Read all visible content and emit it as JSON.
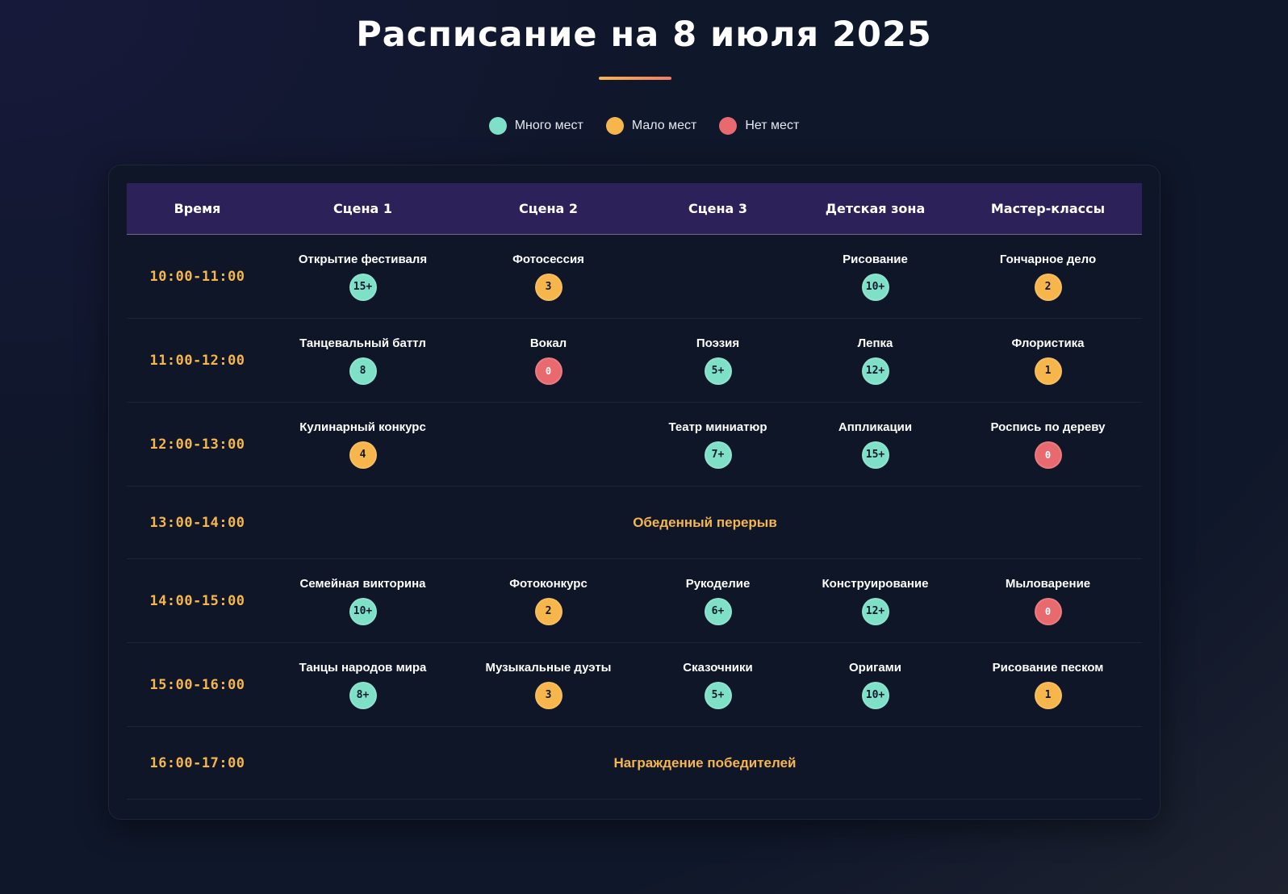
{
  "title": "Расписание на 8 июля 2025",
  "colors": {
    "accent": "#f6b64b",
    "header_bg": "#2c2259",
    "many": "#7fe0c8",
    "few": "#f6b64b",
    "none": "#e86a6e",
    "background": "#0f172a"
  },
  "legend": [
    {
      "status": "many",
      "label": "Много мест"
    },
    {
      "status": "few",
      "label": "Мало мест"
    },
    {
      "status": "none",
      "label": "Нет мест"
    }
  ],
  "table": {
    "headers": [
      "Время",
      "Сцена 1",
      "Сцена 2",
      "Сцена 3",
      "Детская зона",
      "Мастер-классы"
    ],
    "rows": [
      {
        "time": "10:00-11:00",
        "cells": [
          {
            "name": "Открытие фестиваля",
            "seats": "15+",
            "status": "many"
          },
          {
            "name": "Фотосессия",
            "seats": "3",
            "status": "few"
          },
          null,
          {
            "name": "Рисование",
            "seats": "10+",
            "status": "many"
          },
          {
            "name": "Гончарное дело",
            "seats": "2",
            "status": "few"
          }
        ]
      },
      {
        "time": "11:00-12:00",
        "cells": [
          {
            "name": "Танцевальный баттл",
            "seats": "8",
            "status": "many"
          },
          {
            "name": "Вокал",
            "seats": "0",
            "status": "none"
          },
          {
            "name": "Поэзия",
            "seats": "5+",
            "status": "many"
          },
          {
            "name": "Лепка",
            "seats": "12+",
            "status": "many"
          },
          {
            "name": "Флористика",
            "seats": "1",
            "status": "few"
          }
        ]
      },
      {
        "time": "12:00-13:00",
        "cells": [
          {
            "name": "Кулинарный конкурс",
            "seats": "4",
            "status": "few"
          },
          null,
          {
            "name": "Театр миниатюр",
            "seats": "7+",
            "status": "many"
          },
          {
            "name": "Аппликации",
            "seats": "15+",
            "status": "many"
          },
          {
            "name": "Роспись по дереву",
            "seats": "0",
            "status": "none"
          }
        ]
      },
      {
        "time": "13:00-14:00",
        "break": "Обеденный перерыв"
      },
      {
        "time": "14:00-15:00",
        "cells": [
          {
            "name": "Семейная викторина",
            "seats": "10+",
            "status": "many"
          },
          {
            "name": "Фотоконкурс",
            "seats": "2",
            "status": "few"
          },
          {
            "name": "Рукоделие",
            "seats": "6+",
            "status": "many"
          },
          {
            "name": "Конструирование",
            "seats": "12+",
            "status": "many"
          },
          {
            "name": "Мыловарение",
            "seats": "0",
            "status": "none"
          }
        ]
      },
      {
        "time": "15:00-16:00",
        "cells": [
          {
            "name": "Танцы народов мира",
            "seats": "8+",
            "status": "many"
          },
          {
            "name": "Музыкальные дуэты",
            "seats": "3",
            "status": "few"
          },
          {
            "name": "Сказочники",
            "seats": "5+",
            "status": "many"
          },
          {
            "name": "Оригами",
            "seats": "10+",
            "status": "many"
          },
          {
            "name": "Рисование песком",
            "seats": "1",
            "status": "few"
          }
        ]
      },
      {
        "time": "16:00-17:00",
        "break": "Награждение победителей"
      }
    ]
  }
}
